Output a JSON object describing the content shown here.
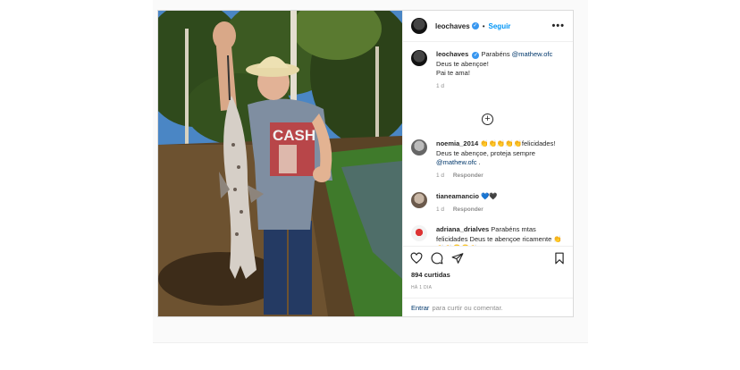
{
  "post": {
    "author": "leochaves",
    "follow_label": "Seguir",
    "more_label": "•••",
    "separator": "•"
  },
  "caption": {
    "user": "leochaves",
    "text_before": "Parabéns ",
    "mention": "@mathew.ofc",
    "line2": "Deus te abençoe!",
    "line3": "Pai te ama!",
    "time": "1 d"
  },
  "load_more_label": "+",
  "comments": [
    {
      "user": "noemia_2014",
      "text": "👏👏👏👏👏felicidades! Deus te abençoe, proteja sempre",
      "mention": "@mathew.ofc",
      "tail": " .",
      "time": "1 d",
      "reply": "Responder"
    },
    {
      "user": "tianeamancio",
      "text": "💙🖤",
      "time": "1 d",
      "reply": "Responder"
    },
    {
      "user": "adriana_drialves",
      "text": "Parabéns mtas felicidades Deus te abençoe ricamente 👏👏👏😀😀👏"
    }
  ],
  "stats": {
    "likes": "894 curtidas",
    "date": "HÁ 1 DIA"
  },
  "add_comment": {
    "link": "Entrar",
    "rest": "para curtir ou comentar."
  },
  "colors": {
    "link_blue": "#0095f6",
    "mention": "#00376b",
    "muted": "#8e8e8e",
    "border": "#dbdbdb"
  }
}
